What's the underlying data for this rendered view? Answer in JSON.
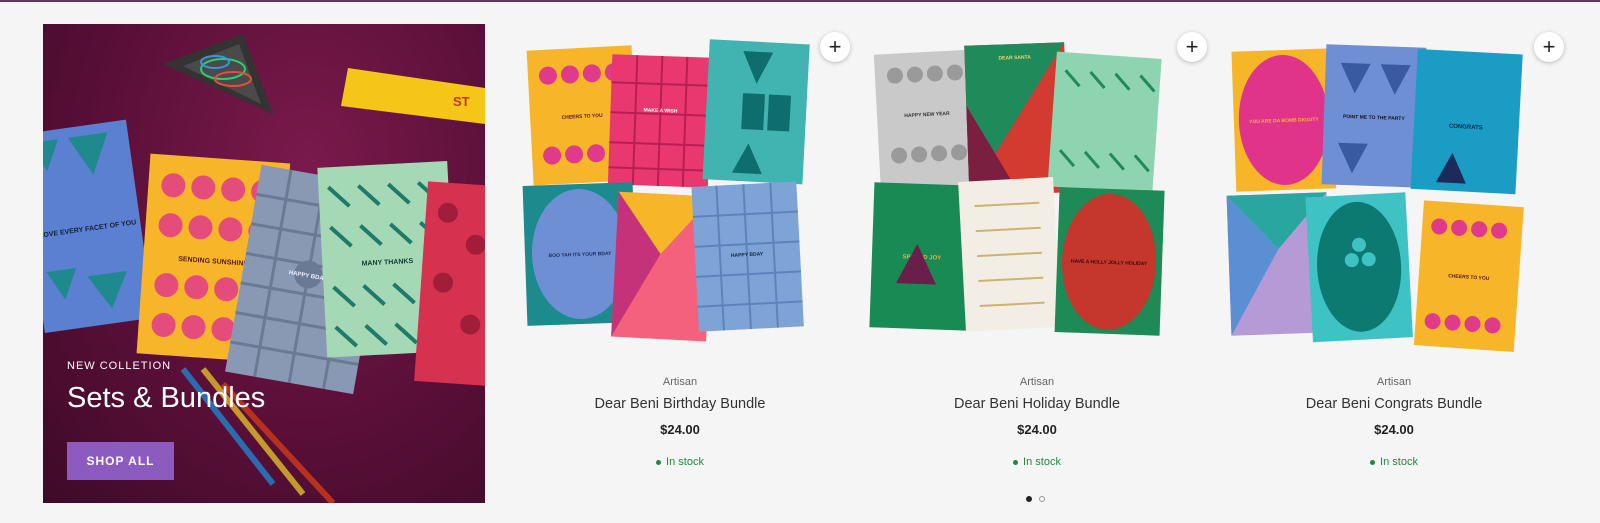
{
  "hero": {
    "eyebrow": "NEW COLLETION",
    "title": "Sets & Bundles",
    "button_label": "SHOP ALL",
    "button_color": "#8c5bbf",
    "background_color": "#5a0f38",
    "card_texts": [
      "I LOVE EVERY FACET OF YOU",
      "SENDING SUNSHINE",
      "HAPPY BDAY",
      "MANY THANKS"
    ],
    "ruler_text": "ST"
  },
  "products": [
    {
      "vendor": "Artisan",
      "name": "Dear Beni Birthday Bundle",
      "price": "$24.00",
      "stock": "In stock",
      "image_texts": [
        "CHEERS TO YOU",
        "MAKE A WISH",
        "BOO YAH ITS YOUR BDAY",
        "HAPPY BDAY"
      ],
      "quick_add_icon": "plus-icon"
    },
    {
      "vendor": "Artisan",
      "name": "Dear Beni Holiday Bundle",
      "price": "$24.00",
      "stock": "In stock",
      "image_texts": [
        "HAPPY NEW YEAR",
        "DEAR SANTA",
        "SPREAD JOY",
        "HAVE A HOLLY JOLLY HOLIDAY"
      ],
      "quick_add_icon": "plus-icon"
    },
    {
      "vendor": "Artisan",
      "name": "Dear Beni Congrats Bundle",
      "price": "$24.00",
      "stock": "In stock",
      "image_texts": [
        "YOU ARE DA BOMB DIGGITY",
        "POINT ME TO THE PARTY",
        "CONGRATS",
        "CHEERS TO YOU"
      ],
      "quick_add_icon": "plus-icon"
    }
  ],
  "pagination": {
    "current": 1,
    "total": 2
  },
  "colors": {
    "in_stock": "#1d8a3c",
    "accent": "#8c5bbf"
  }
}
